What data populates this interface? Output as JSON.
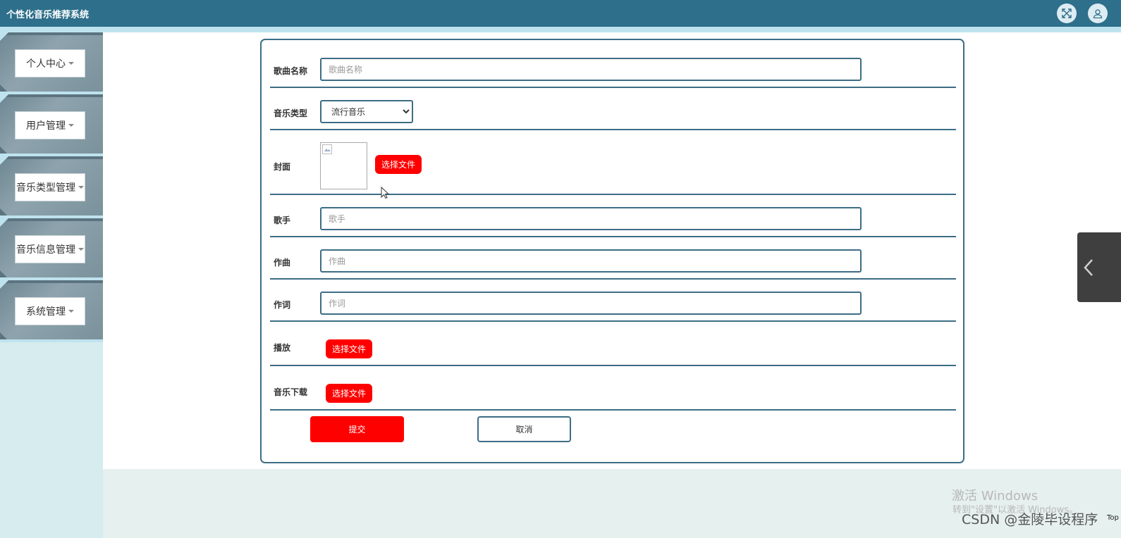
{
  "header": {
    "title": "个性化音乐推荐系统",
    "fullscreen_icon": "fullscreen-icon",
    "user_icon": "user-icon"
  },
  "sidebar": {
    "items": [
      {
        "label": "个人中心"
      },
      {
        "label": "用户管理"
      },
      {
        "label": "音乐类型管理"
      },
      {
        "label": "音乐信息管理"
      },
      {
        "label": "系统管理"
      }
    ]
  },
  "form": {
    "song_name": {
      "label": "歌曲名称",
      "placeholder": "歌曲名称"
    },
    "music_type": {
      "label": "音乐类型",
      "selected": "流行音乐"
    },
    "cover": {
      "label": "封面",
      "button": "选择文件"
    },
    "singer": {
      "label": "歌手",
      "placeholder": "歌手"
    },
    "composer": {
      "label": "作曲",
      "placeholder": "作曲"
    },
    "lyricist": {
      "label": "作词",
      "placeholder": "作词"
    },
    "play": {
      "label": "播放",
      "button": "选择文件"
    },
    "download": {
      "label": "音乐下载",
      "button": "选择文件"
    },
    "submit": "提交",
    "cancel": "取消"
  },
  "overlay": {
    "activate_title": "激活 Windows",
    "activate_sub": "转到\"设置\"以激活 Windows。",
    "csdn": "CSDN @金陵毕设程序",
    "top": "Top"
  },
  "colors": {
    "header": "#2e6f8b",
    "accent_red": "#ff0000",
    "border": "#3d6d85",
    "sidebar": "#bfe3ee"
  }
}
